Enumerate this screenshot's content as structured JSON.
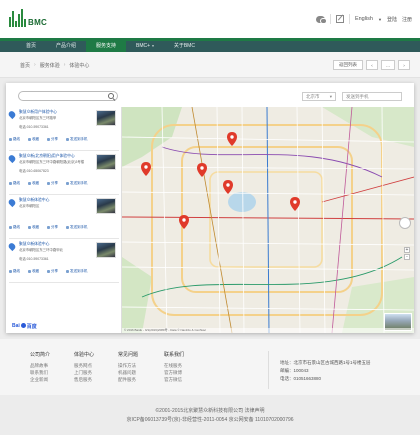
{
  "brand": {
    "logo_text": "BMC"
  },
  "header": {
    "lang": "English",
    "login": "登陆",
    "register": "注册"
  },
  "nav": {
    "items": [
      {
        "label": "首页",
        "active": false,
        "caret": false
      },
      {
        "label": "产品介绍",
        "active": false,
        "caret": false
      },
      {
        "label": "服务支持",
        "active": true,
        "caret": false
      },
      {
        "label": "BMC+",
        "active": false,
        "caret": true
      },
      {
        "label": "关于BMC",
        "active": false,
        "caret": false
      }
    ]
  },
  "breadcrumb": {
    "items": [
      "首页",
      "服务体验",
      "体验中心"
    ]
  },
  "bc_actions": {
    "back": "返回列表",
    "prev": "‹",
    "more": "...",
    "next": "›"
  },
  "search": {
    "placeholder": ""
  },
  "city": {
    "label": "北京市",
    "caret": "▾"
  },
  "mobile": {
    "label": "发送到手机"
  },
  "list": {
    "items": [
      {
        "name": "聚慧众新用户体验中心",
        "addr": "北京市朝阳区东三环路甲",
        "tel": "电话:010-59073361",
        "acts": [
          "路线",
          "收藏",
          "分享",
          "发送到手机"
        ]
      },
      {
        "name": "聚慧众新(北京朝阳)用户体验中心",
        "addr": "北京市朝阳区东三环中路朝阳路(北京)3号楼",
        "tel": "电话:010-65067823",
        "acts": [
          "路线",
          "收藏",
          "分享",
          "发送到手机"
        ]
      },
      {
        "name": "聚慧众新体验中心",
        "addr": "北京市朝阳区",
        "tel": "",
        "acts": [
          "路线",
          "收藏",
          "分享",
          "发送到手机"
        ]
      },
      {
        "name": "聚慧众新体验中心",
        "addr": "北京市朝阳区东三环中路甲北",
        "tel": "电话:010-59073361",
        "acts": [
          "路线",
          "收藏",
          "分享",
          "发送到手机"
        ]
      }
    ]
  },
  "map": {
    "copyright": "© 2016 Baidu - GS(2016)2089号 - Data © NavInfo & CenNavi",
    "baidu_logo": "Bai",
    "baidu_logo2": "百度",
    "zoom_in": "+",
    "zoom_out": "-"
  },
  "footer": {
    "cols": [
      {
        "title": "公司简介",
        "links": [
          "品牌故事",
          "联系我们",
          "企业新闻"
        ]
      },
      {
        "title": "体验中心",
        "links": [
          "服务网点",
          "上门服务",
          "售后服务"
        ]
      },
      {
        "title": "常见问题",
        "links": [
          "操作方法",
          "机器问题",
          "配件服务"
        ]
      },
      {
        "title": "联系我们",
        "links": [
          "在线服务",
          "官方微博",
          "官方微信"
        ]
      }
    ],
    "address": "地址：北京市石景山区古城西路1号1号楼五层",
    "zip": "邮编：100043",
    "phone": "电话：01051663880"
  },
  "copyright": {
    "line1": "©2001-2015北京聚慧众新科技有限公司    法律声明",
    "line2": "京ICP备06013739号(京)-非经营性-2011-0054 京公网安备 11010702000796"
  }
}
